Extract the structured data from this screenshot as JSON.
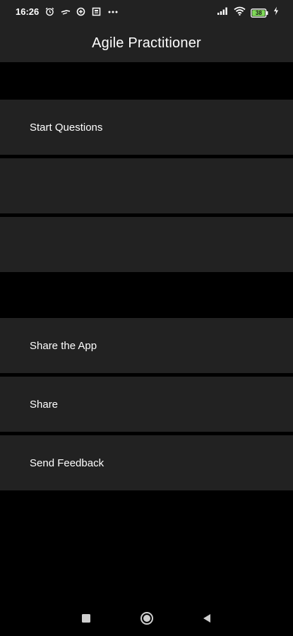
{
  "status_bar": {
    "time": "16:26",
    "battery_level": "38",
    "icons": [
      "alarm-icon",
      "vpn-key-icon",
      "data-saver-icon",
      "news-icon",
      "more-icon",
      "signal-icon",
      "wifi-icon",
      "battery-icon",
      "charging-icon"
    ]
  },
  "app_bar": {
    "title": "Agile Practitioner"
  },
  "menu": {
    "items": [
      {
        "label": "Start Questions"
      },
      {
        "label": ""
      },
      {
        "label": ""
      },
      {
        "label": "Share the App"
      },
      {
        "label": "Share"
      },
      {
        "label": "Send Feedback"
      }
    ]
  },
  "nav_bar": {
    "buttons": [
      "recents-button",
      "home-button",
      "back-button"
    ]
  },
  "colors": {
    "background": "#000000",
    "surface": "#222222",
    "text": "#ffffff",
    "battery_fill": "#7ed957"
  }
}
